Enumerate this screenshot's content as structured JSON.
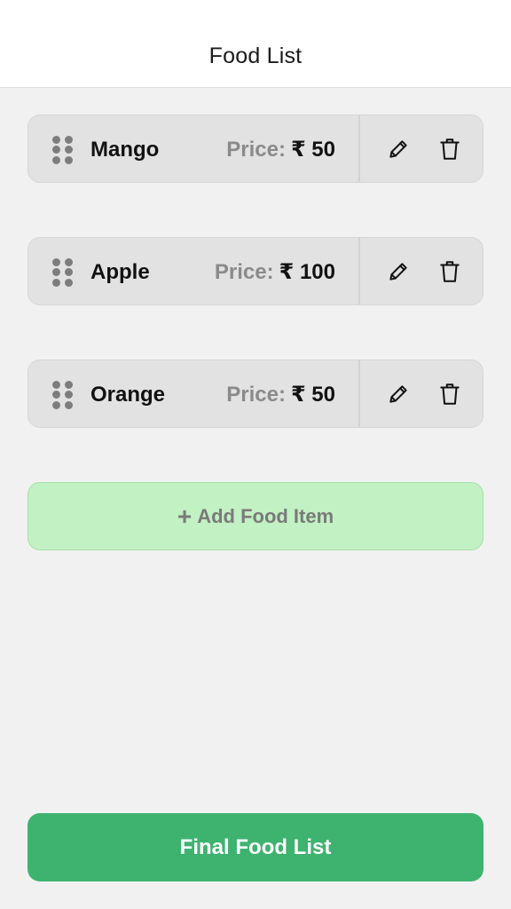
{
  "header": {
    "title": "Food List"
  },
  "items": [
    {
      "name": "Mango",
      "price_label": "Price:",
      "price_value": "₹ 50"
    },
    {
      "name": "Apple",
      "price_label": "Price:",
      "price_value": "₹ 100"
    },
    {
      "name": "Orange",
      "price_label": "Price:",
      "price_value": "₹ 50"
    }
  ],
  "icons": {
    "drag": "drag-handle-icon",
    "edit": "pencil-icon",
    "delete": "trash-icon"
  },
  "add_button": {
    "plus": "+",
    "label": "Add Food Item"
  },
  "final_button": {
    "label": "Final Food List"
  },
  "colors": {
    "add_bg": "#c2f1c3",
    "final_bg": "#3eb370",
    "item_bg": "#e2e2e2",
    "page_bg": "#f1f1f1"
  }
}
